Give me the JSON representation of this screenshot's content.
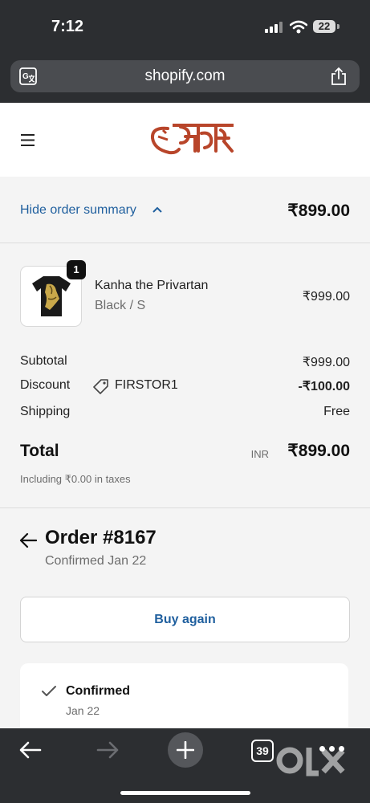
{
  "status_bar": {
    "time": "7:12",
    "battery": "22"
  },
  "browser": {
    "url": "shopify.com",
    "tab_count": "39"
  },
  "brand": {
    "accent": "#b8452a"
  },
  "summary": {
    "toggle_label": "Hide order summary",
    "total": "₹899.00"
  },
  "product": {
    "quantity": "1",
    "name": "Kanha the Privartan",
    "variant": "Black / S",
    "price": "₹999.00"
  },
  "costs": {
    "subtotal_label": "Subtotal",
    "subtotal_value": "₹999.00",
    "discount_label": "Discount",
    "discount_code": "FIRSTOR1",
    "discount_value": "-₹100.00",
    "shipping_label": "Shipping",
    "shipping_value": "Free",
    "total_label": "Total",
    "currency": "INR",
    "total_value": "₹899.00",
    "taxes_note": "Including ₹0.00 in taxes"
  },
  "order": {
    "title": "Order #8167",
    "subtitle": "Confirmed Jan 22",
    "buy_again_label": "Buy again",
    "status_title": "Confirmed",
    "status_date": "Jan 22"
  },
  "icons": {
    "translate": "translate-icon",
    "share": "share-icon",
    "menu": "hamburger-icon",
    "chevron": "chevron-up-icon",
    "tag": "tag-icon",
    "back": "arrow-left-icon",
    "check": "checkmark-icon"
  },
  "colors": {
    "link": "#1f5f9e",
    "chrome": "#2c2e31",
    "background": "#f4f4f4"
  }
}
